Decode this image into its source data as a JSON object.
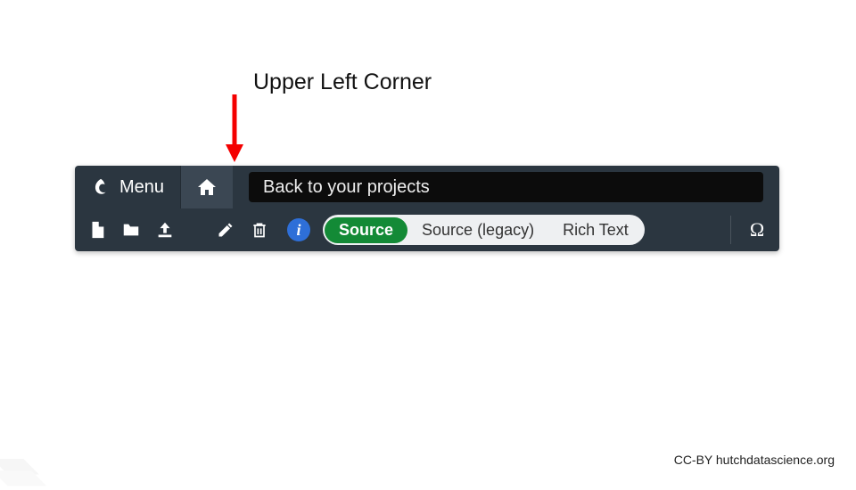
{
  "annotation": {
    "label": "Upper Left Corner"
  },
  "toolbar": {
    "menu_label": "Menu",
    "tooltip_text": "Back to your projects",
    "info_glyph": "i",
    "modes": {
      "source": "Source",
      "source_legacy": "Source (legacy)",
      "rich_text": "Rich Text"
    },
    "omega_glyph": "Ω"
  },
  "attribution": "CC-BY hutchdatascience.org",
  "colors": {
    "toolbar_bg": "#2b3640",
    "home_bg": "#3b4753",
    "tooltip_bg": "#0c0c0c",
    "info_bg": "#2e6fd8",
    "active_mode_bg": "#138a36",
    "arrow": "#f40000"
  }
}
